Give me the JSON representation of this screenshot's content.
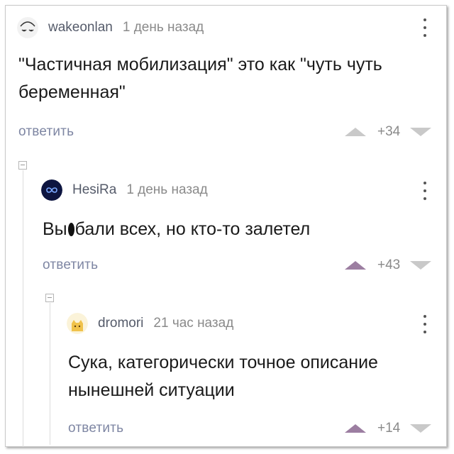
{
  "comments": [
    {
      "username": "wakeonlan",
      "time": "1 день назад",
      "body_lines": [
        "\"Частичная мобилизация\" это как \"чуть чуть",
        "беременная\""
      ],
      "reply_label": "ответить",
      "score": "+34",
      "upvoted": false,
      "avatar_icon": "sleepy-face-icon"
    },
    {
      "username": "HesiRa",
      "time": "1 день назад",
      "body_before": "Вы",
      "body_after": "бали всех, но кто-то залетел",
      "reply_label": "ответить",
      "score": "+43",
      "upvoted": true,
      "avatar_icon": "infinity-icon"
    },
    {
      "username": "dromori",
      "time": "21 час назад",
      "body_lines": [
        "Сука, категорически точное описание",
        "нынешней ситуации"
      ],
      "reply_label": "ответить",
      "score": "+14",
      "upvoted": true,
      "avatar_icon": "cat-icon"
    }
  ],
  "colors": {
    "accent_vote": "#9c7ea1",
    "inactive_vote": "#c9c9c9",
    "reply_link": "#7e86a3"
  }
}
